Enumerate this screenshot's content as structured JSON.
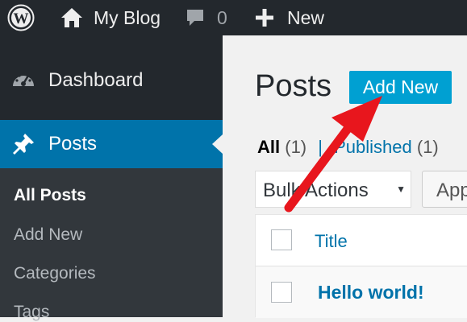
{
  "admin_bar": {
    "site_name": "My Blog",
    "comments_count": "0",
    "new_label": "New"
  },
  "sidebar": {
    "items": [
      {
        "label": "Dashboard",
        "icon": "dashboard-icon"
      },
      {
        "label": "Posts",
        "icon": "pin-icon",
        "current": true
      }
    ],
    "submenu": [
      "All Posts",
      "Add New",
      "Categories",
      "Tags"
    ]
  },
  "main": {
    "title": "Posts",
    "add_new_label": "Add New",
    "views": {
      "all_label": "All",
      "all_count": "(1)",
      "separator": "|",
      "published_label": "Published",
      "published_count": "(1)"
    },
    "bulk_actions_label": "Bulk Actions",
    "apply_label": "Apply",
    "table": {
      "column_title": "Title",
      "rows": [
        "Hello world!"
      ]
    }
  },
  "colors": {
    "admin_bg": "#23282d",
    "submenu_bg": "#32373c",
    "primary_blue": "#0073aa",
    "button_blue": "#00a0d2",
    "annotation_red": "#e8161d"
  }
}
